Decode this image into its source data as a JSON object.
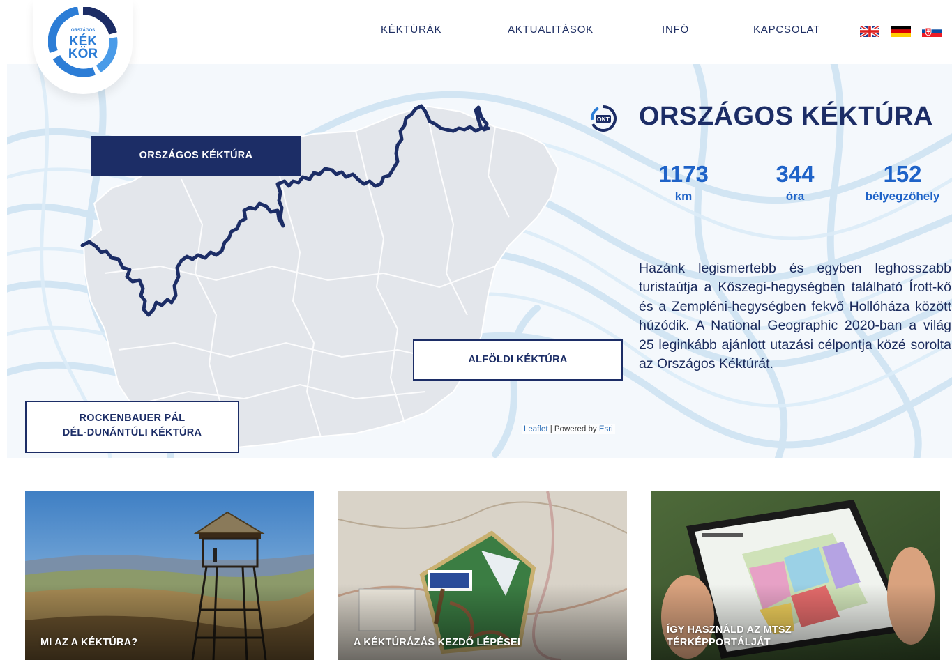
{
  "header": {
    "logo": {
      "small_text": "ORSZÁGOS",
      "line1": "KÉK",
      "line2": "KÖR"
    },
    "nav": [
      {
        "label": "KÉKTÚRÁK"
      },
      {
        "label": "AKTUALITÁSOK"
      },
      {
        "label": "INFÓ"
      },
      {
        "label": "KAPCSOLAT"
      }
    ],
    "languages": [
      {
        "code": "en",
        "icon": "uk-flag-icon"
      },
      {
        "code": "de",
        "icon": "de-flag-icon"
      },
      {
        "code": "sk",
        "icon": "sk-flag-icon"
      }
    ]
  },
  "map": {
    "routes": {
      "okt": "ORSZÁGOS KÉKTÚRA",
      "aft": "ALFÖLDI KÉKTÚRA",
      "ddk_line1": "ROCKENBAUER PÁL",
      "ddk_line2": "DÉL-DUNÁNTÚLI KÉKTÚRA"
    },
    "attribution": {
      "leaflet": "Leaflet",
      "sep": " | Powered by ",
      "esri": "Esri"
    }
  },
  "info": {
    "badge_text": "OKT",
    "title": "ORSZÁGOS KÉKTÚRA",
    "stats": [
      {
        "value": "1173",
        "unit": "km"
      },
      {
        "value": "344",
        "unit": "óra"
      },
      {
        "value": "152",
        "unit": "bélyegzőhely"
      }
    ],
    "description": "Hazánk legismertebb és egyben leghosszabb turistaútja a Kőszegi-hegységben található Írott-kő és a Zempléni-hegységben fekvő Hollóháza között húzódik. A National Geographic 2020-ban a világ 25 leginkább ajánlott utazási célpontja közé sorolta az Országos Kéktúrát."
  },
  "cards": [
    {
      "title": "MI AZ A KÉKTÚRA?"
    },
    {
      "title": "A KÉKTÚRÁZÁS KEZDŐ LÉPÉSEI"
    },
    {
      "title_line1": "ÍGY HASZNÁLD AZ MTSZ",
      "title_line2": "TÉRKÉPPORTÁLJÁT"
    }
  ],
  "colors": {
    "navy": "#1c2d66",
    "accent_blue": "#1f63c8",
    "logo_blue": "#2c7dd6",
    "map_fill": "#e3e6eb",
    "contour": "#cfe3f3"
  }
}
